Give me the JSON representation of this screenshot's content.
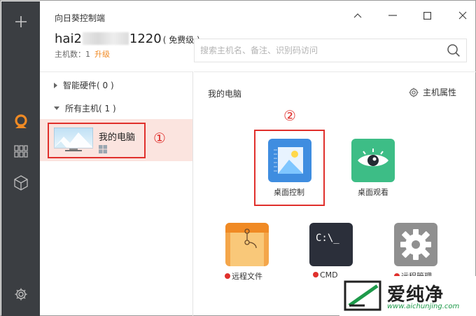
{
  "window": {
    "title": "向日葵控制端",
    "controls": [
      "minimize-icon",
      "restore-icon",
      "maximize-icon",
      "close-icon"
    ]
  },
  "account": {
    "name_prefix": "hai2",
    "name_suffix": "1220",
    "level": "( 免费级 )",
    "host_count_label": "主机数：1",
    "upgrade_label": "升级"
  },
  "search": {
    "placeholder": "搜索主机名、备注、识别码访问"
  },
  "rail": {
    "icons": [
      "plus-icon",
      "sunflower-logo-icon",
      "apps-grid-icon",
      "cube-icon",
      "settings-icon"
    ]
  },
  "tree": {
    "smart_hardware": "智能硬件( 0 )",
    "all_hosts": "所有主机( 1 )",
    "host_name": "我的电脑",
    "marker_1": "①"
  },
  "content": {
    "title": "我的电脑",
    "properties_label": "主机属性",
    "marker_2": "②",
    "tiles": [
      {
        "label": "桌面控制",
        "color": "#3f8de0",
        "icon": "desktop-control-icon"
      },
      {
        "label": "桌面观看",
        "color": "#3dbd86",
        "icon": "eye-icon"
      },
      {
        "label": "远程文件",
        "color": "#f4a64a",
        "icon": "file-folder-icon"
      },
      {
        "label": "CMD",
        "color": "#2b2f3a",
        "icon": "cmd-terminal-icon",
        "glyph": "C:\\_"
      },
      {
        "label": "远程管理",
        "color": "#8f8f8f",
        "icon": "gear-icon"
      }
    ]
  },
  "watermark": {
    "brand": "爱纯净",
    "url": "www.aichunjing.com"
  },
  "colors": {
    "rail_bg": "#3b3e42",
    "accent_orange": "#f08a24",
    "highlight_red": "#e0302c",
    "selection_bg": "#fbe4df"
  }
}
